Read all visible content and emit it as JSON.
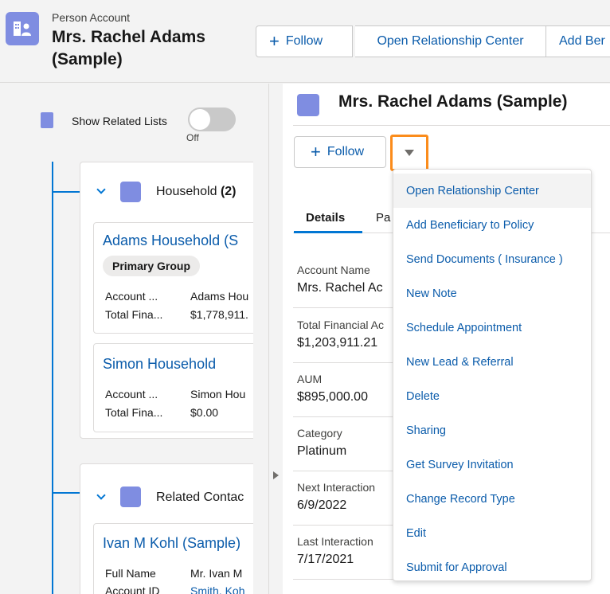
{
  "header": {
    "object_type": "Person Account",
    "title": "Mrs. Rachel Adams (Sample)",
    "buttons": {
      "follow": "Follow",
      "open_relationship_center": "Open Relationship Center",
      "add_beneficiary": "Add Ber"
    }
  },
  "left_panel": {
    "show_related_label": "Show Related Lists",
    "toggle_state": "Off",
    "household_group": {
      "title": "Household",
      "count": "(2)",
      "cards": [
        {
          "name": "Adams Household (S",
          "badge": "Primary Group",
          "rows": [
            {
              "label": "Account ...",
              "value": "Adams Hou"
            },
            {
              "label": "Total Fina...",
              "value": "$1,778,911."
            }
          ]
        },
        {
          "name": "Simon Household",
          "rows": [
            {
              "label": "Account ...",
              "value": "Simon Hou"
            },
            {
              "label": "Total Fina...",
              "value": "$0.00"
            }
          ]
        }
      ]
    },
    "contacts_group": {
      "title": "Related Contac",
      "card": {
        "name": "Ivan M Kohl (Sample)",
        "rows": [
          {
            "label": "Full Name",
            "value": "Mr. Ivan M"
          },
          {
            "label": "Account ID",
            "value": "Smith, Koh"
          }
        ]
      }
    }
  },
  "main": {
    "title": "Mrs. Rachel Adams (Sample)",
    "follow_label": "Follow",
    "tabs": {
      "details": "Details",
      "other": "Pa"
    },
    "fields": [
      {
        "label": "Account Name",
        "value": "Mrs. Rachel Ac"
      },
      {
        "label": "Total Financial Ac",
        "value": "$1,203,911.21"
      },
      {
        "label": "AUM",
        "value": "$895,000.00"
      },
      {
        "label": "Category",
        "value": "Platinum"
      },
      {
        "label": "Next Interaction",
        "value": "6/9/2022"
      },
      {
        "label": "Last Interaction",
        "value": "7/17/2021"
      }
    ]
  },
  "menu": {
    "items": [
      "Open Relationship Center",
      "Add Beneficiary to Policy",
      "Send Documents ( Insurance )",
      "New Note",
      "Schedule Appointment",
      "New Lead & Referral",
      "Delete",
      "Sharing",
      "Get Survey Invitation",
      "Change Record Type",
      "Edit",
      "Submit for Approval"
    ]
  },
  "colors": {
    "accent": "#0176d3",
    "link": "#0b5cab",
    "icon_bg": "#7f8de1",
    "highlight": "#fb8c1b"
  }
}
